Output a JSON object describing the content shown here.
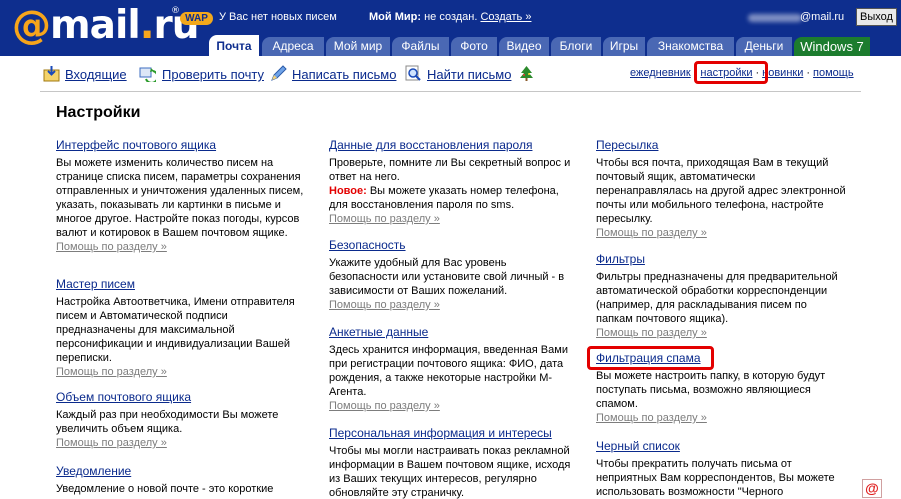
{
  "header": {
    "logo_at": "@",
    "logo_text": "mail",
    "logo_dot": ".",
    "logo_ru": "ru",
    "logo_reg": "®",
    "wap": "WAP",
    "no_new_mail": "У Вас нет новых писем",
    "my_world_label": "Мой Мир:",
    "my_world_status": "не создан.",
    "create_link": "Создать »",
    "email_suffix": "@mail.ru",
    "logout_label": "Выход"
  },
  "tabs": [
    {
      "label": "Почта",
      "active": true
    },
    {
      "label": "Адреса"
    },
    {
      "label": "Мой мир"
    },
    {
      "label": "Файлы"
    },
    {
      "label": "Фото"
    },
    {
      "label": "Видео"
    },
    {
      "label": "Блоги"
    },
    {
      "label": "Игры"
    },
    {
      "label": "Знакомства"
    },
    {
      "label": "Деньги"
    },
    {
      "label": "Windows 7"
    }
  ],
  "toolbar": {
    "inbox": "Входящие",
    "check_mail": "Проверить почту",
    "compose": "Написать письмо",
    "find_mail": "Найти письмо",
    "right_links": {
      "daily": "ежедневник",
      "settings": "настройки",
      "news": "новинки",
      "help": "помощь"
    }
  },
  "page_title": "Настройки",
  "help_link": "Помощь по разделу »",
  "columns": [
    [
      {
        "title": "Интерфейс почтового ящика",
        "desc": "Вы можете изменить количество писем на странице списка писем, параметры сохранения отправленных и уничтожения удаленных писем, указать, показывать ли картинки в письме и многое другое. Настройте показ погоды, курсов валют и котировок в Вашем почтовом ящике."
      },
      {
        "title": "Мастер писем",
        "desc": "Настройка Автоответчика, Имени отправителя писем и Автоматической подписи предназначены для максимальной персонификации и индивидуализации Вашей переписки."
      },
      {
        "title": "Объем почтового ящика",
        "desc": "Каждый раз при необходимости Вы можете увеличить объем ящика."
      },
      {
        "title": "Уведомление",
        "desc": "Уведомление о новой почте - это короткие"
      }
    ],
    [
      {
        "title": "Данные для восстановления пароля",
        "desc": "Проверьте, помните ли Вы секретный вопрос и ответ на него.",
        "new_label": "Новое:",
        "new_text": " Вы можете указать номер телефона, для восстановления пароля по sms."
      },
      {
        "title": "Безопасность",
        "desc": "Укажите удобный для Вас уровень безопасности или установите свой личный - в зависимости от Ваших пожеланий."
      },
      {
        "title": "Анкетные данные",
        "desc": "Здесь хранится информация, введенная Вами при регистрации почтового ящика: ФИО, дата рождения, а также некоторые настройки М-Агента."
      },
      {
        "title": "Персональная информация и интересы",
        "desc": "Чтобы мы могли настраивать показ рекламной информации в Вашем почтовом ящике, исходя из Ваших текущих интересов, регулярно обновляйте эту страничку."
      }
    ],
    [
      {
        "title": "Пересылка",
        "desc": "Чтобы вся почта, приходящая Вам в текущий почтовый ящик, автоматически перенаправлялась на другой адрес электронной почты или мобильного телефона, настройте пересылку."
      },
      {
        "title": "Фильтры",
        "desc": "Фильтры предназначены для предварительной автоматической обработки корреспонденции (например, для раскладывания писем по папкам почтового ящика)."
      },
      {
        "title": "Фильтрация спама",
        "desc": "Вы можете настроить папку, в которую будут поступать письма, возможно являющиеся спамом."
      },
      {
        "title": "Черный список",
        "desc": "Чтобы прекратить получать письма от неприятных Вам корреспондентов, Вы можете использовать возможности \"Черного"
      }
    ]
  ],
  "corner_icon": "@",
  "colors": {
    "header_bg": "#0e2e8e",
    "tab_bg": "#4a68b4",
    "win7_tab": "#1c7c2e",
    "accent_orange": "#f7a51b",
    "link": "#0a2a8c",
    "highlight_red": "#e30000"
  }
}
